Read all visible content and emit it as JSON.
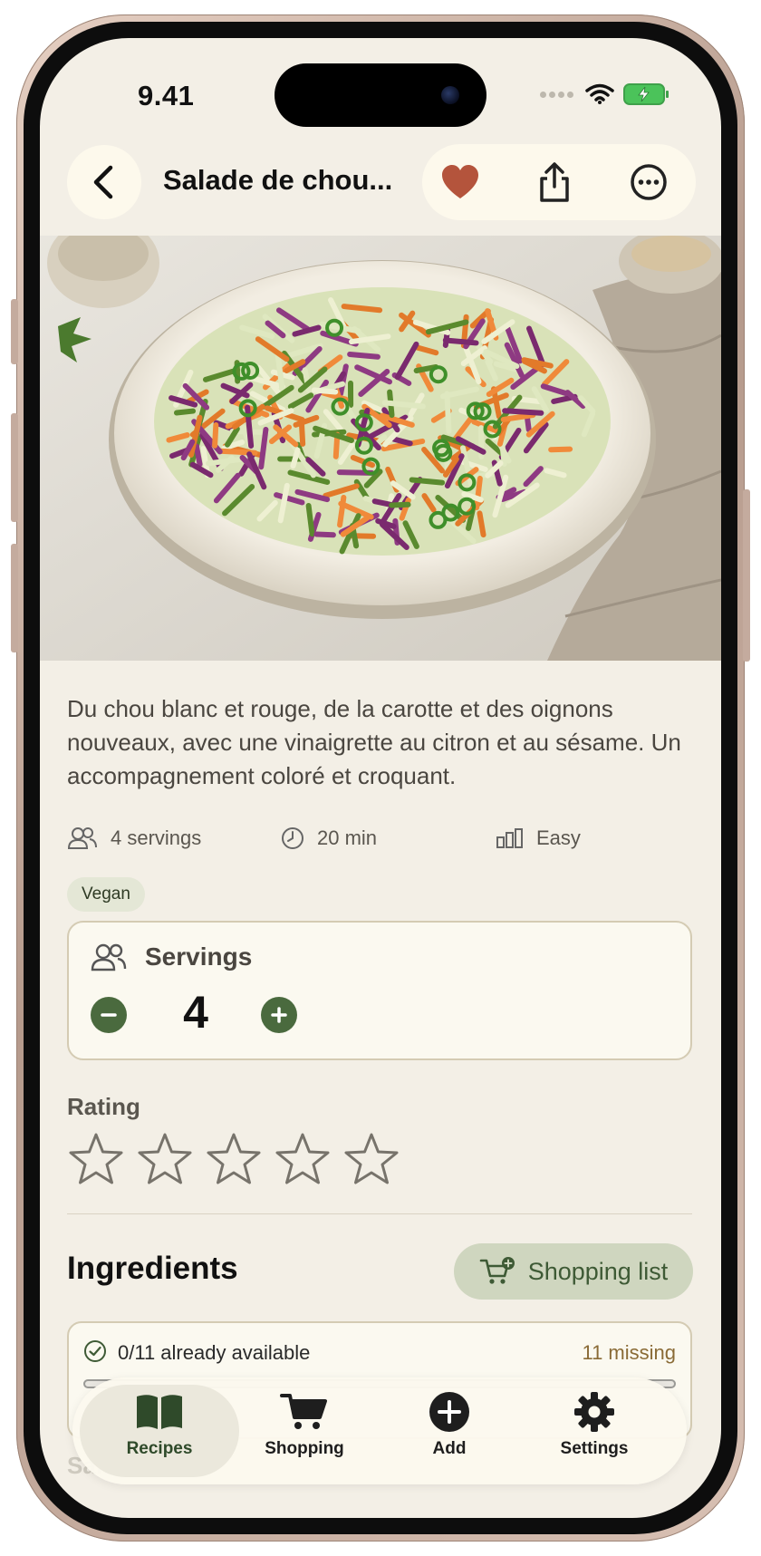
{
  "status_bar": {
    "time": "9.41"
  },
  "header": {
    "title": "Salade de chou..."
  },
  "recipe": {
    "description": "Du chou blanc et rouge, de la carotte et des oignons nouveaux, avec une vinaigrette au citron et au sésame. Un accompagnement coloré et croquant.",
    "servings_meta": "4 servings",
    "time_meta": "20 min",
    "difficulty_meta": "Easy",
    "tag": "Vegan"
  },
  "servings_card": {
    "label": "Servings",
    "count": "4"
  },
  "rating": {
    "label": "Rating",
    "value": 0,
    "max": 5
  },
  "ingredients": {
    "title": "Ingredients",
    "shopping_button": "Shopping list",
    "available_text": "0/11 already available",
    "missing_text": "11 missing",
    "progress": 0,
    "next_section_hint": "Salad"
  },
  "tabbar": {
    "tabs": [
      {
        "label": "Recipes",
        "icon": "book-icon",
        "active": true
      },
      {
        "label": "Shopping",
        "icon": "cart-icon",
        "active": false
      },
      {
        "label": "Add",
        "icon": "plus-circle-icon",
        "active": false
      },
      {
        "label": "Settings",
        "icon": "gear-icon",
        "active": false
      }
    ]
  },
  "colors": {
    "accent": "#4a6a3e",
    "heart": "#b4543c",
    "background": "#f3efe6",
    "missing": "#8a6b36"
  }
}
